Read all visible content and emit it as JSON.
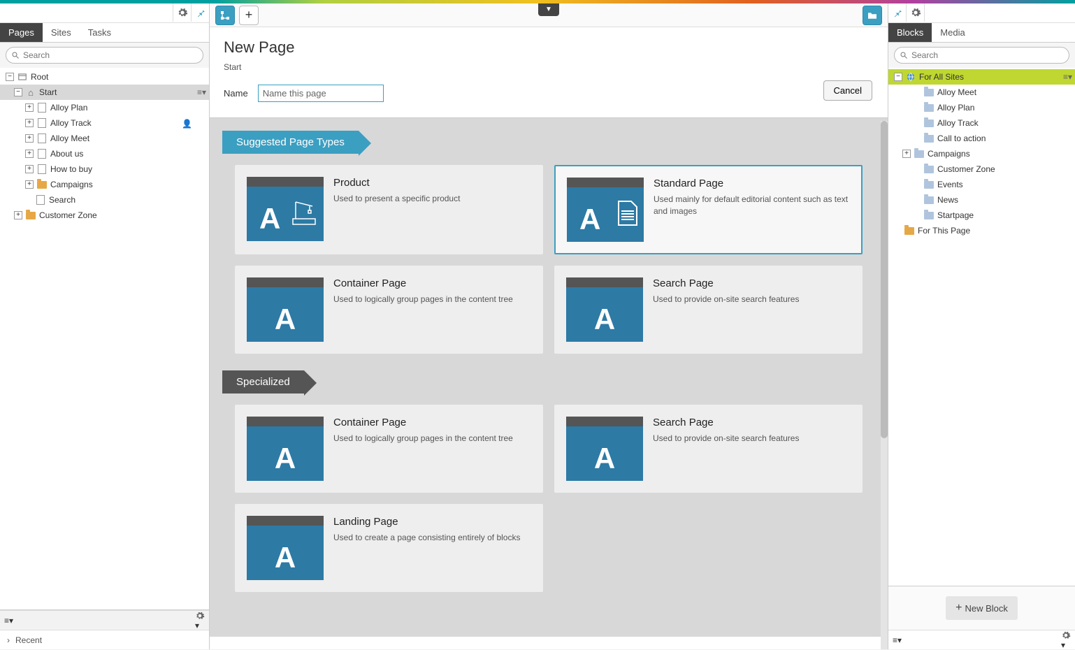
{
  "leftPanel": {
    "tabs": {
      "pages": "Pages",
      "sites": "Sites",
      "tasks": "Tasks"
    },
    "searchPlaceholder": "Search",
    "tree": {
      "root": "Root",
      "start": "Start",
      "items": [
        "Alloy Plan",
        "Alloy Track",
        "Alloy Meet",
        "About us",
        "How to buy",
        "Campaigns",
        "Search",
        "Customer Zone"
      ]
    },
    "recent": "Recent"
  },
  "centerTop": {},
  "newPage": {
    "title": "New Page",
    "crumb": "Start",
    "cancel": "Cancel",
    "nameLabel": "Name",
    "nameValue": "Name this page"
  },
  "sections": {
    "suggested": "Suggested Page Types",
    "specialized": "Specialized"
  },
  "cards": {
    "product": {
      "title": "Product",
      "desc": "Used to present a specific product"
    },
    "standard": {
      "title": "Standard Page",
      "desc": "Used mainly for default editorial content such as text and images"
    },
    "container": {
      "title": "Container Page",
      "desc": "Used to logically group pages in the content tree"
    },
    "search": {
      "title": "Search Page",
      "desc": "Used to provide on-site search features"
    },
    "landing": {
      "title": "Landing Page",
      "desc": "Used to create a page consisting entirely of blocks"
    }
  },
  "rightPanel": {
    "tabs": {
      "blocks": "Blocks",
      "media": "Media"
    },
    "searchPlaceholder": "Search",
    "tree": {
      "forAllSites": "For All Sites",
      "items": [
        "Alloy Meet",
        "Alloy Plan",
        "Alloy Track",
        "Call to action",
        "Campaigns",
        "Customer Zone",
        "Events",
        "News",
        "Startpage"
      ],
      "forThisPage": "For This Page"
    },
    "newBlock": "New Block"
  }
}
